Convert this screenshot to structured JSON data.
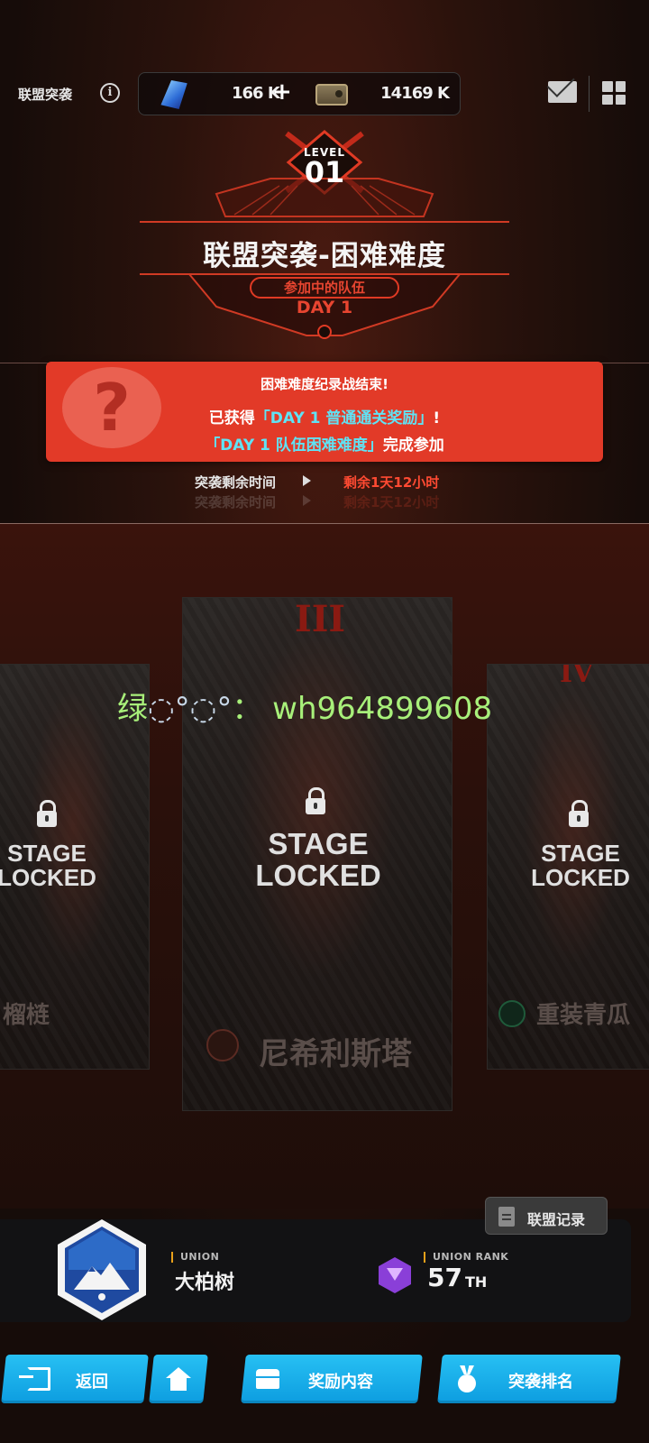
{
  "header": {
    "title": "联盟突袭",
    "gem_amount": "166 K",
    "ticket_amount": "14169 K"
  },
  "emblem": {
    "level_label": "LEVEL",
    "level_number": "01",
    "title": "联盟突袭-困难难度",
    "subtitle": "参加中的队伍",
    "day": "DAY 1"
  },
  "notice": {
    "line1": "困难难度纪录战结束!",
    "line2_prefix": "已获得",
    "line2_highlight": "「DAY 1 普通通关奖励」",
    "line2_suffix": "!",
    "line3_highlight": "「DAY 1 队伍困难难度」",
    "line3_suffix": "完成参加",
    "icon": "question-mark"
  },
  "timer": {
    "label": "突袭剩余时间",
    "value": "剩余1天12小时"
  },
  "stages": [
    {
      "roman": "",
      "status": "STAGE LOCKED",
      "boss": "榴梿"
    },
    {
      "roman": "III",
      "status": "STAGE LOCKED",
      "boss": "尼希利斯塔"
    },
    {
      "roman": "IV",
      "status": "STAGE LOCKED",
      "boss": "重装青瓜"
    }
  ],
  "watermark": {
    "prefix": "绿",
    "suffix": "： wh964899608"
  },
  "union": {
    "record_label": "联盟记录",
    "union_tag": "UNION",
    "union_name": "大柏树",
    "rank_tag": "UNION RANK",
    "rank_value": "57",
    "rank_suffix": "TH"
  },
  "buttons": {
    "back": "返回",
    "rewards": "奖励内容",
    "ranking": "突袭排名"
  }
}
